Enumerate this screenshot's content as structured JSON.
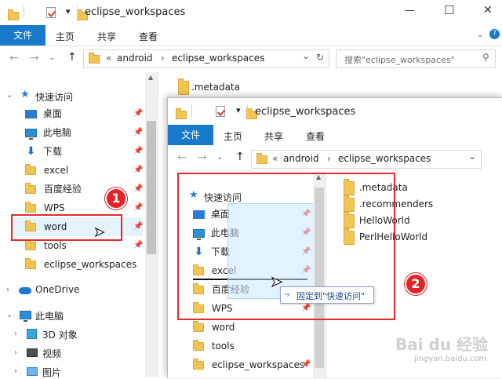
{
  "back_window": {
    "title": "eclipse_workspaces",
    "controls": {
      "minimize": "—",
      "maximize": "☐",
      "close": "✕"
    },
    "ribbon_tabs": [
      "文件",
      "主页",
      "共享",
      "查看"
    ],
    "address": {
      "back": "←",
      "forward": "→",
      "up": "↑",
      "prefix": "«",
      "crumbs": [
        "android",
        "eclipse_workspaces"
      ],
      "sep": "›",
      "dropdown": "⌄",
      "refresh": "↻"
    },
    "search_placeholder": "搜索\"eclipse_workspaces\"",
    "sidebar": {
      "quick_access": "快速访问",
      "items": [
        "桌面",
        "此电脑",
        "下载",
        "excel",
        "百度经验",
        "WPS",
        "word",
        "tools",
        "eclipse_workspaces"
      ],
      "onedrive": "OneDrive",
      "this_pc": "此电脑",
      "pc_items": [
        "3D 对象",
        "视频",
        "图片"
      ]
    },
    "content_items": [
      ".metadata"
    ],
    "pin": "📌"
  },
  "front_window": {
    "title": "eclipse_workspaces",
    "ribbon_tabs": [
      "文件",
      "主页",
      "共享",
      "查看"
    ],
    "address": {
      "back": "←",
      "forward": "→",
      "up": "↑",
      "prefix": "«",
      "crumbs": [
        "android",
        "eclipse_workspaces"
      ],
      "sep": "›",
      "dropdown": "⌄"
    },
    "sidebar": {
      "quick_access": "快速访问",
      "items": [
        "桌面",
        "此电脑",
        "下载",
        "excel",
        "百度经验",
        "WPS",
        "word",
        "tools",
        "eclipse_workspaces"
      ]
    },
    "content_items": [
      ".metadata",
      ".recommenders",
      "HelloWorld",
      "PerlHelloWorld"
    ],
    "tooltip": "固定到\"快速访问\"",
    "tooltip_icon": "⤷"
  },
  "annotations": {
    "badge1": "1",
    "badge2": "2"
  },
  "watermark": {
    "text": "Bai du 经验",
    "sub": "jingyan.baidu.com"
  }
}
